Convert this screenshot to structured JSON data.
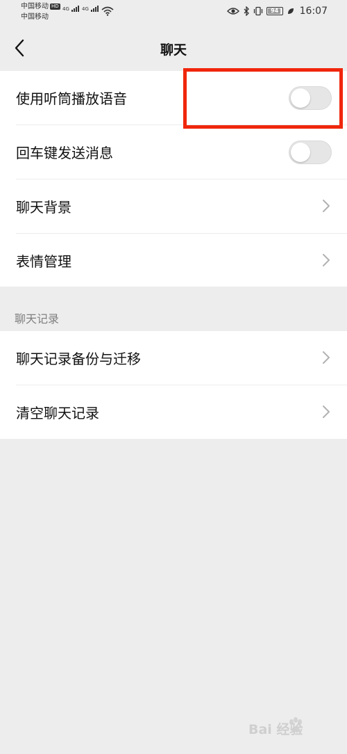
{
  "status_bar": {
    "carrier1": "中国移动",
    "carrier1_badge": "HD",
    "carrier2": "中国移动",
    "network1": "4G",
    "network2": "4G",
    "battery": "94",
    "time": "16:07"
  },
  "nav": {
    "title": "聊天",
    "back_icon": "chevron-left-icon"
  },
  "settings": [
    {
      "label": "使用听筒播放语音",
      "control": "toggle",
      "on": false
    },
    {
      "label": "回车键发送消息",
      "control": "toggle",
      "on": false
    },
    {
      "label": "聊天背景",
      "control": "chevron"
    },
    {
      "label": "表情管理",
      "control": "chevron"
    }
  ],
  "history_section": {
    "header": "聊天记录",
    "items": [
      {
        "label": "聊天记录备份与迁移",
        "control": "chevron"
      },
      {
        "label": "清空聊天记录",
        "control": "chevron"
      }
    ]
  },
  "watermark": {
    "text": "Bai 经验"
  },
  "colors": {
    "background": "#ededed",
    "highlight": "#f0260c",
    "toggle_off": "#e6e6e6"
  }
}
